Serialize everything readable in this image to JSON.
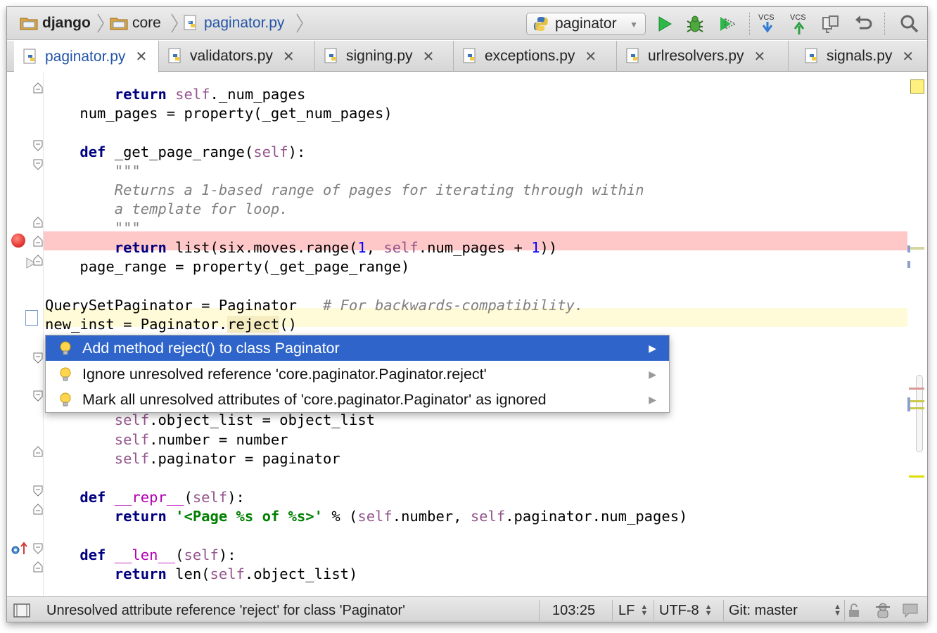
{
  "breadcrumb": {
    "items": [
      {
        "label": "django",
        "icon": "folder-icon"
      },
      {
        "label": "core",
        "icon": "folder-icon"
      },
      {
        "label": "paginator.py",
        "icon": "python-file-icon"
      }
    ]
  },
  "toolbar": {
    "run_config_label": "paginator",
    "buttons": [
      "run-icon",
      "debug-icon",
      "coverage-icon",
      "vcs-update-icon",
      "vcs-commit-icon",
      "compare-icon",
      "revert-icon",
      "search-icon"
    ],
    "vcs_label": "VCS"
  },
  "tabs": [
    {
      "label": "paginator.py",
      "active": true
    },
    {
      "label": "validators.py",
      "active": false
    },
    {
      "label": "signing.py",
      "active": false
    },
    {
      "label": "exceptions.py",
      "active": false
    },
    {
      "label": "urlresolvers.py",
      "active": false
    },
    {
      "label": "signals.py",
      "active": false
    }
  ],
  "tab_close_glyph": "✕",
  "popup": {
    "items": [
      {
        "label": "Add method reject() to class Paginator",
        "selected": true
      },
      {
        "label": "Ignore unresolved reference 'core.paginator.Paginator.reject'",
        "selected": false
      },
      {
        "label": "Mark all unresolved attributes of 'core.paginator.Paginator' as ignored",
        "selected": false
      }
    ]
  },
  "status": {
    "message": "Unresolved attribute reference 'reject' for class 'Paginator'",
    "position": "103:25",
    "line_separator": "LF",
    "encoding": "UTF-8",
    "vcs_branch": "Git: master"
  },
  "colors": {
    "accent_selection": "#2f65ca",
    "breakpoint_line": "#ffc8c8",
    "current_line": "#fffbd8",
    "keyword": "#000080",
    "self": "#94558d",
    "string": "#008000"
  }
}
